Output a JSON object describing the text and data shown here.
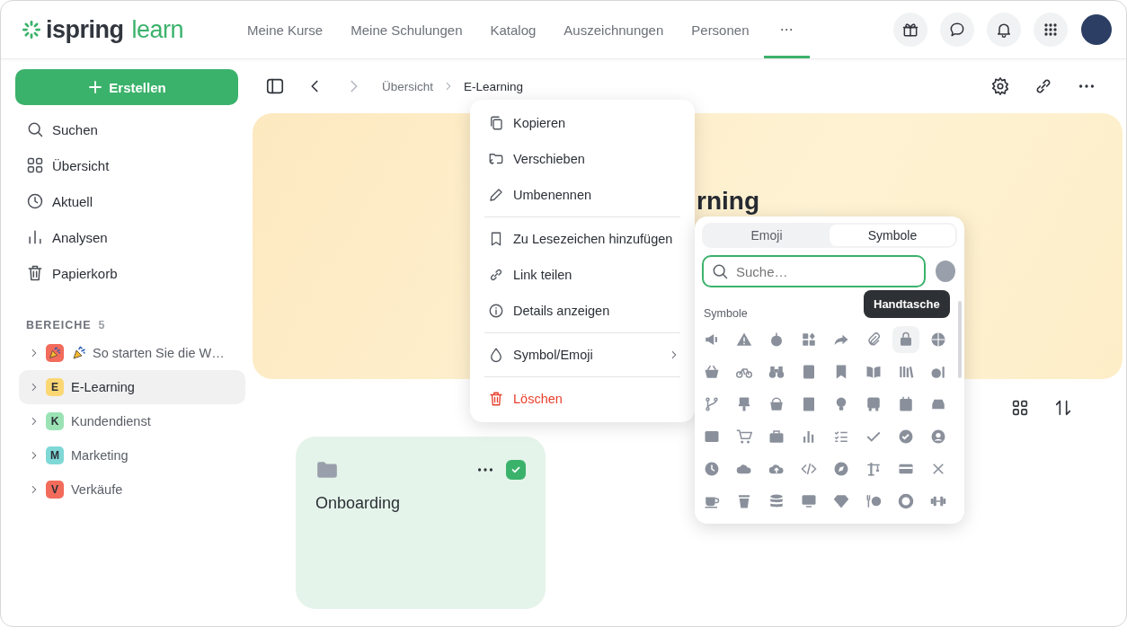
{
  "logo": {
    "brand": "ispring",
    "product": "learn"
  },
  "nav": [
    {
      "label": "Meine Kurse",
      "selected": false
    },
    {
      "label": "Meine Schulungen",
      "selected": false
    },
    {
      "label": "Katalog",
      "selected": false
    },
    {
      "label": "Auszeichnungen",
      "selected": false
    },
    {
      "label": "Personen",
      "selected": false
    },
    {
      "label": "⋯",
      "selected": true
    }
  ],
  "sidebar": {
    "create_button": "Erstellen",
    "items": [
      {
        "label": "Suchen"
      },
      {
        "label": "Übersicht"
      },
      {
        "label": "Aktuell"
      },
      {
        "label": "Analysen"
      },
      {
        "label": "Papierkorb"
      }
    ],
    "section": {
      "title": "BEREICHE",
      "count": "5"
    },
    "areas": [
      {
        "kind": "emoji",
        "label": "So starten Sie die W…",
        "color": "#f26b5b",
        "selected": false
      },
      {
        "kind": "letter",
        "badge": "E",
        "label": "E-Learning",
        "color": "#fbd774",
        "selected": true
      },
      {
        "kind": "letter",
        "badge": "K",
        "label": "Kundendienst",
        "color": "#9be3b5",
        "selected": false
      },
      {
        "kind": "letter",
        "badge": "M",
        "label": "Marketing",
        "color": "#7fd8d6",
        "selected": false
      },
      {
        "kind": "letter",
        "badge": "V",
        "label": "Verkäufe",
        "color": "#f26b5b",
        "selected": false
      }
    ]
  },
  "toolbar": {
    "forward_disabled": true,
    "breadcrumb": [
      "Übersicht",
      "E-Learning"
    ]
  },
  "banner": {
    "title": "rning"
  },
  "cards": [
    {
      "title": "Onboarding",
      "checked": true
    }
  ],
  "context_menu": {
    "groups": [
      [
        {
          "label": "Kopieren",
          "kind": "action"
        },
        {
          "label": "Verschieben",
          "kind": "action"
        },
        {
          "label": "Umbenennen",
          "kind": "action"
        }
      ],
      [
        {
          "label": "Zu Lesezeichen hinzufügen",
          "kind": "action"
        },
        {
          "label": "Link teilen",
          "kind": "action"
        },
        {
          "label": "Details anzeigen",
          "kind": "action"
        }
      ],
      [
        {
          "label": "Symbol/Emoji",
          "kind": "submenu"
        }
      ],
      [
        {
          "label": "Löschen",
          "kind": "danger"
        }
      ]
    ]
  },
  "picker": {
    "tabs": [
      {
        "label": "Emoji",
        "selected": false
      },
      {
        "label": "Symbole",
        "selected": true
      }
    ],
    "search": {
      "placeholder": "Suche…"
    },
    "section": "Symbole",
    "tooltip": "Handtasche",
    "symbols": [
      {
        "hovered": false
      },
      {
        "hovered": false
      },
      {
        "hovered": false
      },
      {
        "hovered": false
      },
      {
        "hovered": false
      },
      {
        "hovered": false
      },
      {
        "hovered": true
      },
      {
        "hovered": false
      },
      {
        "hovered": false
      },
      {
        "hovered": false
      },
      {
        "hovered": false
      },
      {
        "hovered": false
      },
      {
        "hovered": false
      },
      {
        "hovered": false
      },
      {
        "hovered": false
      },
      {
        "hovered": false
      },
      {
        "hovered": false
      },
      {
        "hovered": false
      },
      {
        "hovered": false
      },
      {
        "hovered": false
      },
      {
        "hovered": false
      },
      {
        "hovered": false
      },
      {
        "hovered": false
      },
      {
        "hovered": false
      },
      {
        "hovered": false
      },
      {
        "hovered": false
      },
      {
        "hovered": false
      },
      {
        "hovered": false
      },
      {
        "hovered": false
      },
      {
        "hovered": false
      },
      {
        "hovered": false
      },
      {
        "hovered": false
      },
      {
        "hovered": false
      },
      {
        "hovered": false
      },
      {
        "hovered": false
      },
      {
        "hovered": false
      },
      {
        "hovered": false
      },
      {
        "hovered": false
      },
      {
        "hovered": false
      },
      {
        "hovered": false
      },
      {
        "hovered": false
      },
      {
        "hovered": false
      },
      {
        "hovered": false
      },
      {
        "hovered": false
      },
      {
        "hovered": false
      },
      {
        "hovered": false
      },
      {
        "hovered": false
      },
      {
        "hovered": false
      }
    ]
  }
}
